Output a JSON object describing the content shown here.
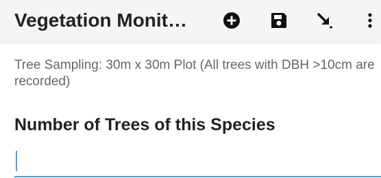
{
  "appbar": {
    "title": "Vegetation Monit…",
    "icons": {
      "add": "plus-circle-icon",
      "save": "floppy-disk-icon",
      "jump": "arrow-down-right-icon",
      "more": "more-vertical-icon"
    }
  },
  "question": {
    "hint": "Tree Sampling: 30m x 30m Plot (All trees with DBH >10cm are recorded)",
    "label": "Number of Trees of this Species",
    "value": ""
  },
  "colors": {
    "accent": "#4aa3df",
    "appbar_bg": "#f5f5f5",
    "text": "#222222",
    "hint_text": "#666666"
  }
}
